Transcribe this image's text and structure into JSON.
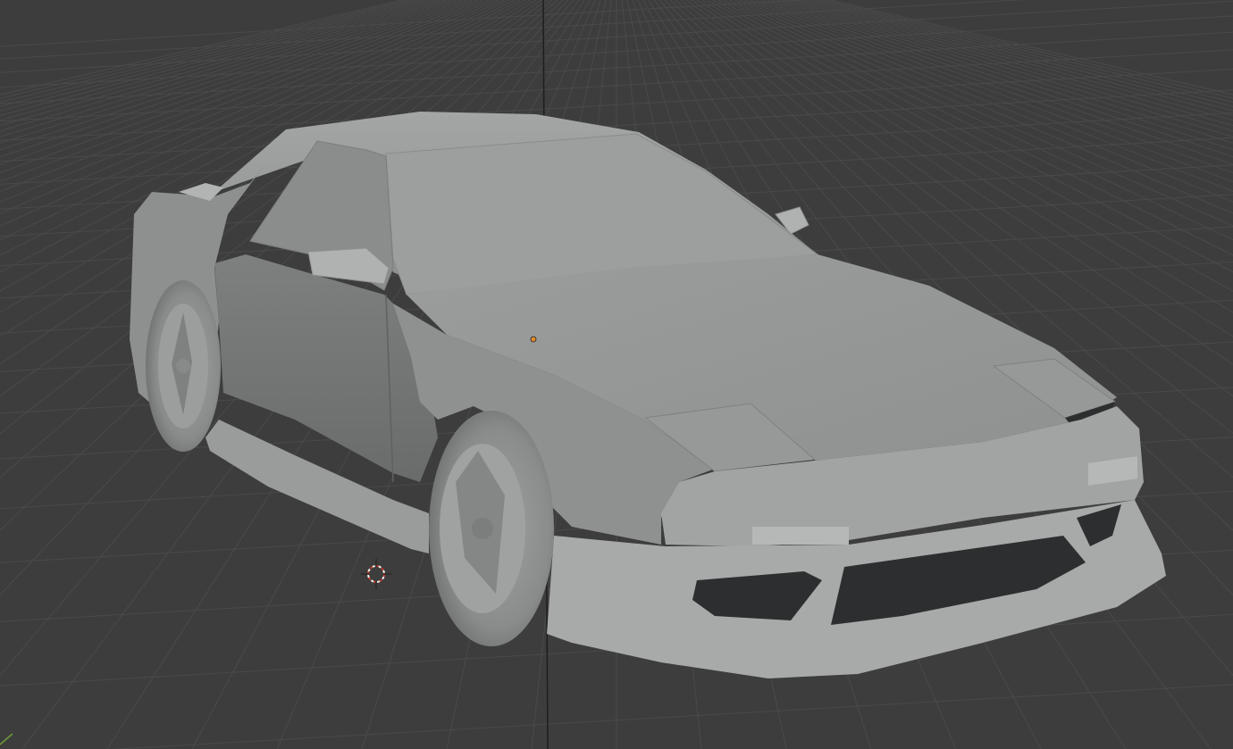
{
  "viewport": {
    "background": "#3d3d3d",
    "grid_line_color": "#4a4a4a",
    "z_axis_color": "#1e1e1e",
    "y_axis_color": "#6f9a3a",
    "origin_color": "#e0892b",
    "cursor_colors": [
      "#c0392b",
      "#f2f2f2"
    ]
  },
  "model": {
    "shading": "solid",
    "body_color": "#9a9c9c",
    "shadow_color": "#6f7171",
    "dark_opening_color": "#2c2e2f"
  }
}
